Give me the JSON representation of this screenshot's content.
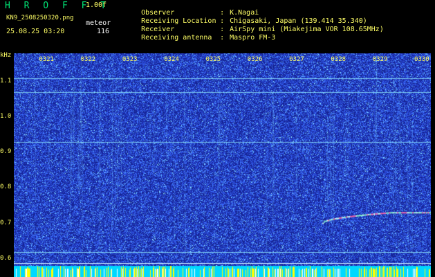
{
  "header": {
    "logo": "H R O F F T",
    "version": "1.00f",
    "filename": "KN9_2508250320.png",
    "meteor_label": "meteor",
    "datetime": "25.08.25 03:20",
    "meteor_count": "116",
    "info": [
      {
        "label": "Observer",
        "value": "K.Nagai"
      },
      {
        "label": "Receiving Location",
        "value": "Chigasaki, Japan (139.414 35.340)"
      },
      {
        "label": "Receiver",
        "value": "AirSpy mini (Miakejima VOR 108.65MHz)"
      },
      {
        "label": "Receiving antenna",
        "value": "Maspro FM-3"
      }
    ]
  },
  "chart_data": {
    "type": "heatmap",
    "ylabel": "kHz",
    "y_ticks": [
      "1.1",
      "1.0",
      "0.9",
      "0.8",
      "0.7",
      "0.6"
    ],
    "x_ticks": [
      "0321",
      "0322",
      "0323",
      "0324",
      "0325",
      "0326",
      "0327",
      "0328",
      "0329",
      "0330"
    ],
    "ylim": [
      0.58,
      1.18
    ],
    "xlim": [
      "03:20",
      "03:30"
    ],
    "horizontal_lines_khz": [
      1.11,
      1.07,
      0.93,
      0.62
    ],
    "meteor_trace": {
      "start": "03:27.4",
      "end": "03:30",
      "khz_start": 0.7,
      "khz_end": 0.73
    },
    "colors": {
      "background": "#1a2ba8",
      "noise": "#3a6cff",
      "line": "#8fe8ff",
      "text": "#ffff66",
      "logo": "#00e676",
      "bottom_bar": "#00d8ff"
    }
  }
}
